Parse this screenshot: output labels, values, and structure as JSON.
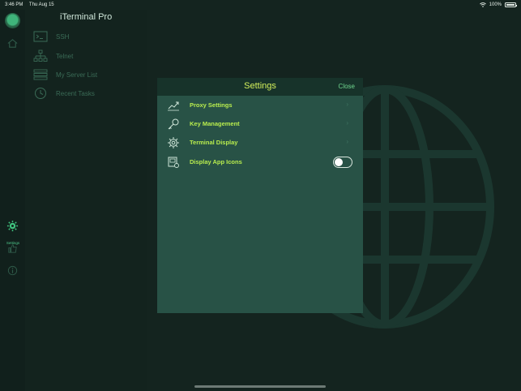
{
  "status_bar": {
    "time": "3:46 PM",
    "date": "Thu Aug 15",
    "battery": "100%"
  },
  "app": {
    "title": "iTerminal Pro"
  },
  "rail": {
    "settings_label": "Settings"
  },
  "sidebar": {
    "items": [
      {
        "label": "SSH",
        "icon": "terminal-icon"
      },
      {
        "label": "Telnet",
        "icon": "network-icon"
      },
      {
        "label": "My Server List",
        "icon": "server-list-icon"
      },
      {
        "label": "Recent Tasks",
        "icon": "clock-icon"
      }
    ]
  },
  "settings_modal": {
    "title": "Settings",
    "close_label": "Close",
    "rows": [
      {
        "label": "Proxy Settings",
        "icon": "trend-icon"
      },
      {
        "label": "Key Management",
        "icon": "key-icon"
      },
      {
        "label": "Terminal Display",
        "icon": "gear-icon"
      },
      {
        "label": "Display App Icons",
        "icon": "app-icons-icon",
        "toggle_on": false
      }
    ]
  },
  "colors": {
    "accent": "#b8ec4e",
    "background": "#14241f",
    "modal": "#285246"
  }
}
